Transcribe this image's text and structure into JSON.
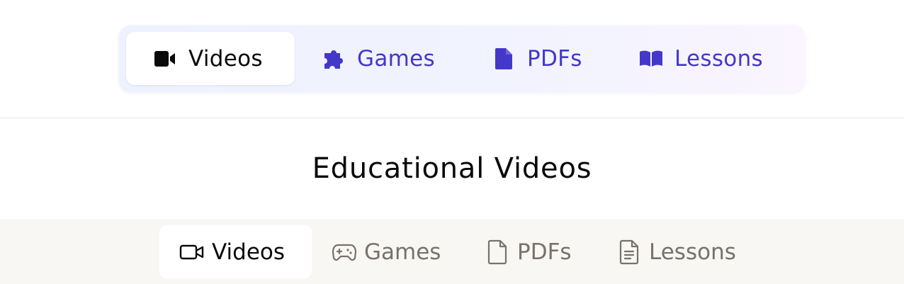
{
  "top_tabs": {
    "items": [
      {
        "label": "Videos",
        "icon": "video-camera-solid-icon",
        "active": true
      },
      {
        "label": "Games",
        "icon": "puzzle-piece-icon",
        "active": false
      },
      {
        "label": "PDFs",
        "icon": "document-solid-icon",
        "active": false
      },
      {
        "label": "Lessons",
        "icon": "book-open-icon",
        "active": false
      }
    ],
    "colors": {
      "active_text": "#0a0a0a",
      "inactive_text": "#4338ca",
      "background_start": "#eef2ff",
      "background_end": "#faf5ff"
    }
  },
  "section": {
    "title": "Educational Videos"
  },
  "bottom_tabs": {
    "items": [
      {
        "label": "Videos",
        "icon": "video-camera-outline-icon",
        "active": true
      },
      {
        "label": "Games",
        "icon": "gamepad-icon",
        "active": false
      },
      {
        "label": "PDFs",
        "icon": "file-outline-icon",
        "active": false
      },
      {
        "label": "Lessons",
        "icon": "file-text-icon",
        "active": false
      }
    ],
    "colors": {
      "active_text": "#0a0a0a",
      "inactive_text": "#78716c",
      "background": "#f8f7f4"
    }
  }
}
